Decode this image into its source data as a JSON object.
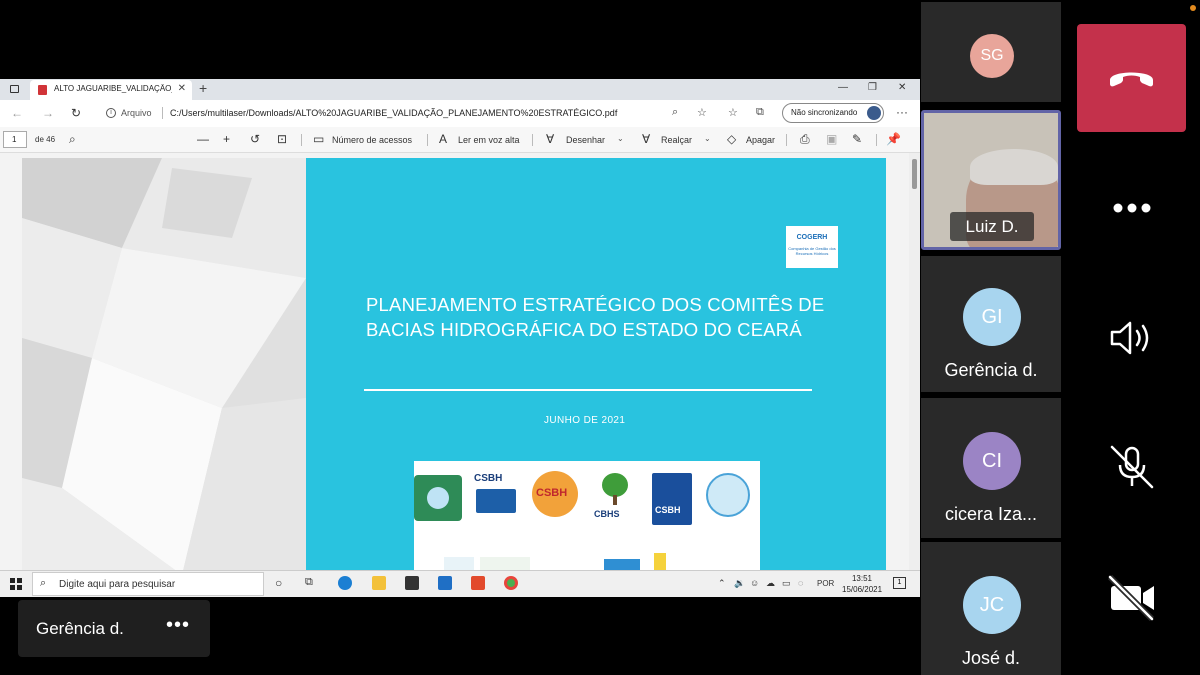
{
  "browser": {
    "tab_title": "ALTO JAGUARIBE_VALIDAÇÃO_P...",
    "address_label": "Arquivo",
    "url": "C:/Users/multilaser/Downloads/ALTO%20JAGUARIBE_VALIDAÇÃO_PLANEJAMENTO%20ESTRATÉGICO.pdf",
    "sync_label": "Não sincronizando"
  },
  "pdf_toolbar": {
    "page_current": "1",
    "page_total": "de 46",
    "access_label": "Número de acessos",
    "read_aloud_label": "Ler em voz alta",
    "draw_label": "Desenhar",
    "highlight_label": "Realçar",
    "erase_label": "Apagar"
  },
  "document": {
    "logo_text": "COGERH",
    "logo_subtext": "Companhia de Gestão dos Recursos Hídricos",
    "title": "PLANEJAMENTO ESTRATÉGICO DOS COMITÊS DE BACIAS HIDROGRÁFICA DO ESTADO DO CEARÁ",
    "date": "JUNHO DE 2021",
    "committee_logos": [
      "CSBH",
      "CSBH",
      "CBHS",
      "CSBH"
    ]
  },
  "taskbar": {
    "search_placeholder": "Digite aqui para pesquisar",
    "language": "POR",
    "time": "13:51",
    "date": "15/06/2021",
    "notification_count": "1"
  },
  "meeting": {
    "presenter_name": "Gerência d.",
    "participants": [
      {
        "initials": "SG",
        "name": "",
        "avatar_color": "#e8a59a",
        "initials_color": "#ffffff"
      },
      {
        "initials": "",
        "name": "Luiz D.",
        "avatar_color": "",
        "initials_color": ""
      },
      {
        "initials": "GI",
        "name": "Gerência d.",
        "avatar_color": "#a8d5ef",
        "initials_color": "#ffffff"
      },
      {
        "initials": "CI",
        "name": "cicera Iza...",
        "avatar_color": "#9b84c5",
        "initials_color": "#ffffff"
      },
      {
        "initials": "JC",
        "name": "José d.",
        "avatar_color": "#a8d5ef",
        "initials_color": "#ffffff"
      }
    ],
    "controls": [
      "leave-call",
      "more-options",
      "speaker",
      "microphone-muted",
      "camera-off"
    ],
    "accent_color": "#6264a7",
    "leave_color": "#c4314b"
  }
}
